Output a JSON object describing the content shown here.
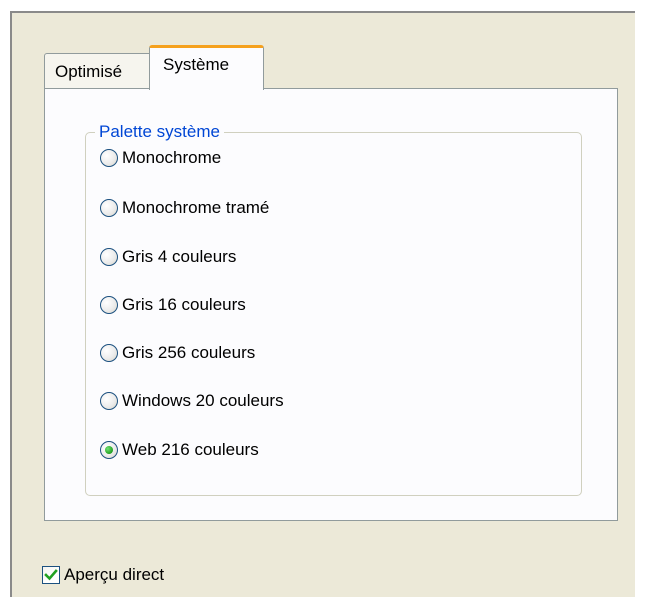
{
  "tabs": [
    {
      "label": "Optimisé",
      "active": false
    },
    {
      "label": "Système",
      "active": true
    }
  ],
  "palette_group": {
    "legend": "Palette système",
    "options": [
      {
        "label": "Monochrome",
        "checked": false
      },
      {
        "label": "Monochrome tramé",
        "checked": false
      },
      {
        "label": "Gris 4 couleurs",
        "checked": false
      },
      {
        "label": "Gris 16 couleurs",
        "checked": false
      },
      {
        "label": "Gris 256 couleurs",
        "checked": false
      },
      {
        "label": "Windows 20 couleurs",
        "checked": false
      },
      {
        "label": "Web 216 couleurs",
        "checked": true
      }
    ]
  },
  "live_preview": {
    "label": "Aperçu direct",
    "checked": true
  },
  "colors": {
    "legend_blue": "#0046d5",
    "active_tab_accent": "#f5a11d",
    "panel_bg": "#fcfcfe",
    "dialog_bg": "#ece9d8",
    "radio_dot": "#21a121",
    "check_mark": "#21a121"
  }
}
